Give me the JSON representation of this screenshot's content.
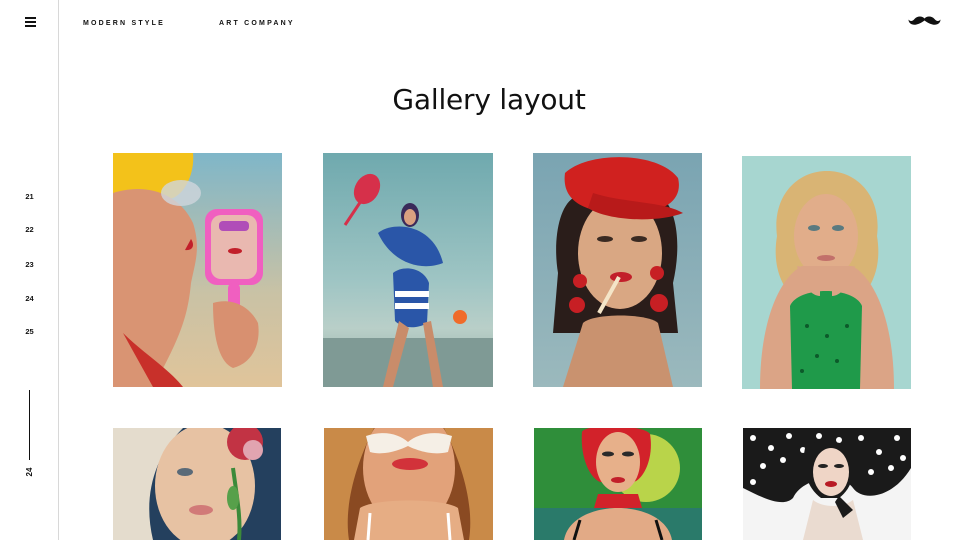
{
  "nav": {
    "menu_icon": "hamburger-menu-icon",
    "links": [
      "MODERN STYLE",
      "ART COMPANY"
    ]
  },
  "logo": {
    "icon": "mustache-icon"
  },
  "page_title": "Gallery layout",
  "sidebar": {
    "pages": [
      "21",
      "22",
      "23",
      "24",
      "25"
    ],
    "current_page": "24"
  },
  "gallery": {
    "images": [
      {
        "subject": "woman-yellow-swim-cap-pink-mirror"
      },
      {
        "subject": "woman-blue-swimsuit-red-racket"
      },
      {
        "subject": "woman-red-cap-cigarette"
      },
      {
        "subject": "blonde-woman-green-swimsuit"
      },
      {
        "subject": "woman-with-red-carnation"
      },
      {
        "subject": "woman-white-sunglasses"
      },
      {
        "subject": "woman-red-headscarf-green-background"
      },
      {
        "subject": "woman-polka-dot-hat"
      }
    ]
  },
  "colors": {
    "accent": "#111111",
    "divider": "#d8d8d8"
  }
}
